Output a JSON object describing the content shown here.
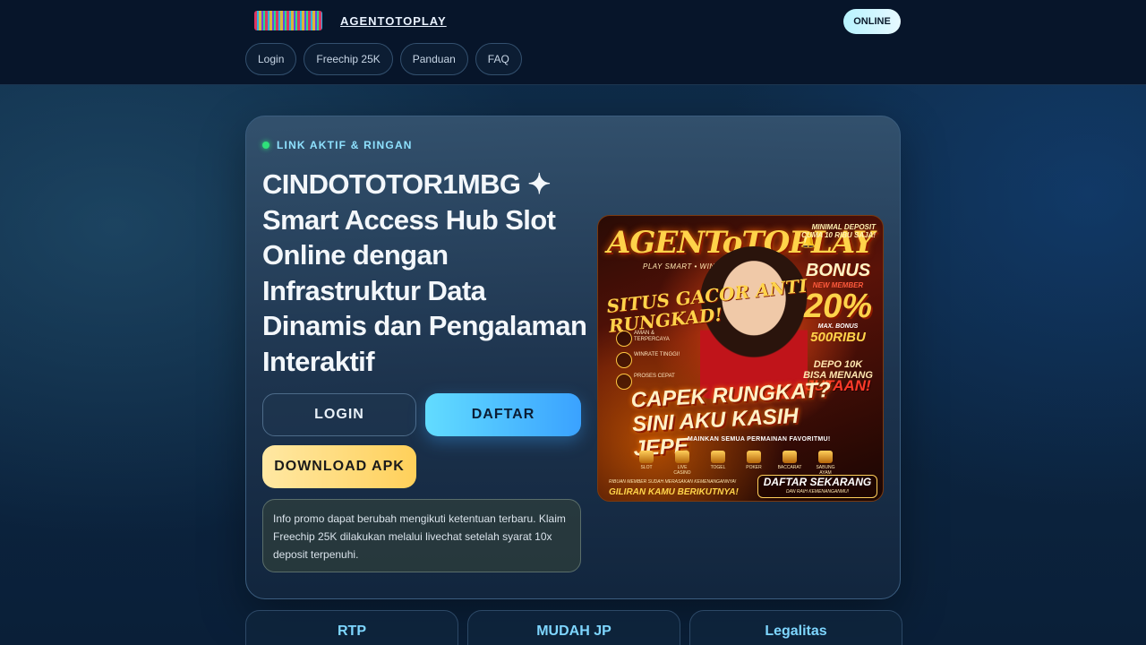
{
  "header": {
    "brand": "AGENTOTOPLAY",
    "status_badge": "ONLINE",
    "nav": [
      "Login",
      "Freechip 25K",
      "Panduan",
      "FAQ"
    ]
  },
  "hero": {
    "eyebrow": "LINK AKTIF & RINGAN",
    "title": "CINDOTOTOR1MBG ✦ Smart Access Hub Slot Online dengan Infrastruktur Data Dinamis dan Pengalaman Interaktif",
    "buttons": {
      "login": "LOGIN",
      "daftar": "DAFTAR",
      "apk": "DOWNLOAD APK"
    },
    "info": "Info promo dapat berubah mengikuti ketentuan terbaru. Klaim Freechip 25K dilakukan melalui livechat setelah syarat 10x deposit terpenuhi."
  },
  "poster": {
    "brand": "AGENToTOPLAY",
    "tagline": "PLAY SMART • WIN BIG • REPEAT",
    "min_deposit": "MINIMAL DEPOSIT CUMA 10 RIBU SAJA!",
    "situs": "SITUS GACOR ANTI RUNGKAD!",
    "features": [
      "AMAN & TERPERCAYA",
      "WINRATE TINGGI!",
      "PROSES CEPAT"
    ],
    "bonus_label": "BONUS",
    "bonus_sub": "NEW MEMBER",
    "bonus_pct": "20%",
    "bonus_max": "MAX. BONUS",
    "bonus_amount": "500RIBU",
    "depo": "DEPO 10K BISA MENANG",
    "depo_big": "JUTAAN!",
    "headline": "CAPEK RUNGKAT? SINI AKU KASIH JEPE",
    "mainkan": "MAINKAN SEMUA PERMAINAN FAVORITMU!",
    "games": [
      "SLOT",
      "LIVE CASINO",
      "TOGEL",
      "POKER",
      "BACCARAT",
      "SABUNG AYAM"
    ],
    "footer_left_small": "RIBUAN MEMBER SUDAH MERASAKAN KEMENANGANNYA!",
    "footer_left": "GILIRAN KAMU BERIKUTNYA!",
    "footer_right": "DAFTAR SEKARANG",
    "footer_right_small": "DAN RAIH KEMENANGANMU!"
  },
  "tiles": [
    "RTP",
    "MUDAH JP",
    "Legalitas"
  ]
}
